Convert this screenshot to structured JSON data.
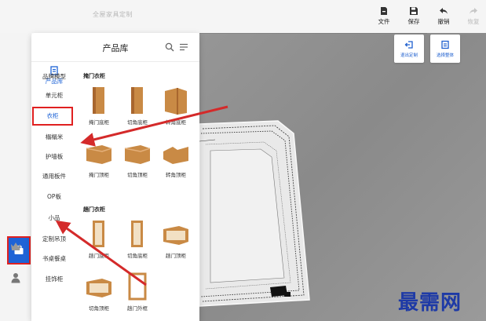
{
  "scene_title": "全屋家具定制",
  "toolbar": [
    {
      "name": "file-button",
      "icon": "file-icon",
      "label": "文件",
      "enabled": true
    },
    {
      "name": "save-button",
      "icon": "save-icon",
      "label": "保存",
      "enabled": true
    },
    {
      "name": "undo-button",
      "icon": "undo-icon",
      "label": "撤销",
      "enabled": true
    },
    {
      "name": "redo-button",
      "icon": "redo-icon",
      "label": "恢复",
      "enabled": false
    }
  ],
  "viewport_panels": {
    "exit_custom": "退出定制",
    "select_all": "选择整体"
  },
  "left_rail": {
    "icons": [
      "product-library-icon",
      "crown-icon",
      "user-icon"
    ]
  },
  "product_panel": {
    "title": "产品库",
    "category_header": "产品库",
    "categories": [
      "品牌模型",
      "单元柜",
      "衣柜",
      "榻榻米",
      "护墙板",
      "通用板件",
      "OP板",
      "小品",
      "定制吊顶",
      "书桌餐桌",
      "挂饰柜"
    ],
    "active_category": "衣柜",
    "sections": [
      {
        "title": "掩门衣柜",
        "items": [
          {
            "label": "掩门底柜",
            "icon": "tall-cabinet-icon"
          },
          {
            "label": "切角底柜",
            "icon": "tall-cabinet-icon"
          },
          {
            "label": "转角底柜",
            "icon": "corner-cabinet-icon"
          },
          {
            "label": "掩门顶柜",
            "icon": "top-cabinet-icon"
          },
          {
            "label": "切角顶柜",
            "icon": "top-cabinet-icon"
          },
          {
            "label": "转角顶柜",
            "icon": "corner-top-cabinet-icon"
          }
        ]
      },
      {
        "title": "趟门衣柜",
        "items": [
          {
            "label": "趟门底柜",
            "icon": "open-tall-cabinet-icon"
          },
          {
            "label": "切角底柜",
            "icon": "open-tall-cabinet-icon"
          },
          {
            "label": "趟门顶柜",
            "icon": "open-top-cabinet-icon"
          },
          {
            "label": "切角顶柜",
            "icon": "open-top-cabinet-icon"
          },
          {
            "label": "趟门外框",
            "icon": "frame-icon"
          }
        ]
      }
    ]
  },
  "watermark": "最需网",
  "colors": {
    "accent": "#1e63d6",
    "highlight": "#e02020",
    "wood": "#c98a45"
  }
}
